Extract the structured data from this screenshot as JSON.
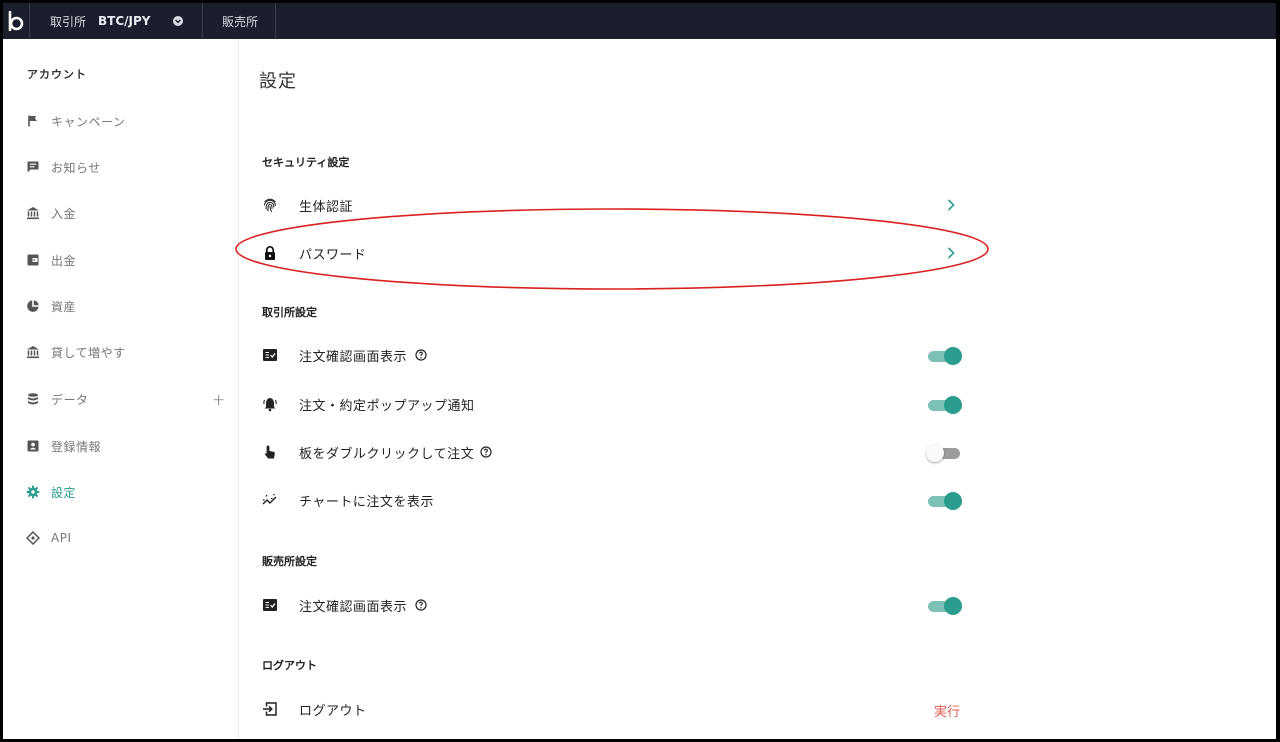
{
  "topbar": {
    "exchange_label": "取引所",
    "pair": "BTC/JPY",
    "sales_label": "販売所"
  },
  "sidebar": {
    "header": "アカウント",
    "items": [
      {
        "label": "キャンペーン",
        "icon": "flag-icon"
      },
      {
        "label": "お知らせ",
        "icon": "message-icon"
      },
      {
        "label": "入金",
        "icon": "bank-icon"
      },
      {
        "label": "出金",
        "icon": "wallet-icon"
      },
      {
        "label": "資産",
        "icon": "pie-chart-icon"
      },
      {
        "label": "貸して増やす",
        "icon": "bank-icon"
      },
      {
        "label": "データ",
        "icon": "database-icon",
        "expand": "+"
      },
      {
        "label": "登録情報",
        "icon": "id-badge-icon"
      },
      {
        "label": "設定",
        "icon": "gear-icon",
        "active": true
      },
      {
        "label": "API",
        "icon": "api-icon"
      }
    ]
  },
  "main": {
    "title": "設定",
    "sections": {
      "security": {
        "title": "セキュリティ設定",
        "rows": [
          {
            "label": "生体認証",
            "icon": "fingerprint-icon"
          },
          {
            "label": "パスワード",
            "icon": "lock-icon"
          }
        ]
      },
      "exchange": {
        "title": "取引所設定",
        "rows": [
          {
            "label": "注文確認画面表示",
            "icon": "checklist-icon",
            "help": true,
            "toggle": "on"
          },
          {
            "label": "注文・約定ポップアップ通知",
            "icon": "bell-icon",
            "toggle": "on"
          },
          {
            "label": "板をダブルクリックして注文",
            "icon": "hand-pointer-icon",
            "help": true,
            "toggle": "off"
          },
          {
            "label": "チャートに注文を表示",
            "icon": "chart-line-icon",
            "toggle": "on"
          }
        ]
      },
      "sales": {
        "title": "販売所設定",
        "rows": [
          {
            "label": "注文確認画面表示",
            "icon": "checklist-icon",
            "help": true,
            "toggle": "on"
          }
        ]
      },
      "logout": {
        "title": "ログアウト",
        "rows": [
          {
            "label": "ログアウト",
            "icon": "logout-icon",
            "action": "実行"
          }
        ]
      }
    }
  },
  "colors": {
    "topbar_bg": "#1b1f2d",
    "accent": "#2a9d8f",
    "danger": "#e05a4e",
    "highlight_ellipse": "#d9221f"
  }
}
